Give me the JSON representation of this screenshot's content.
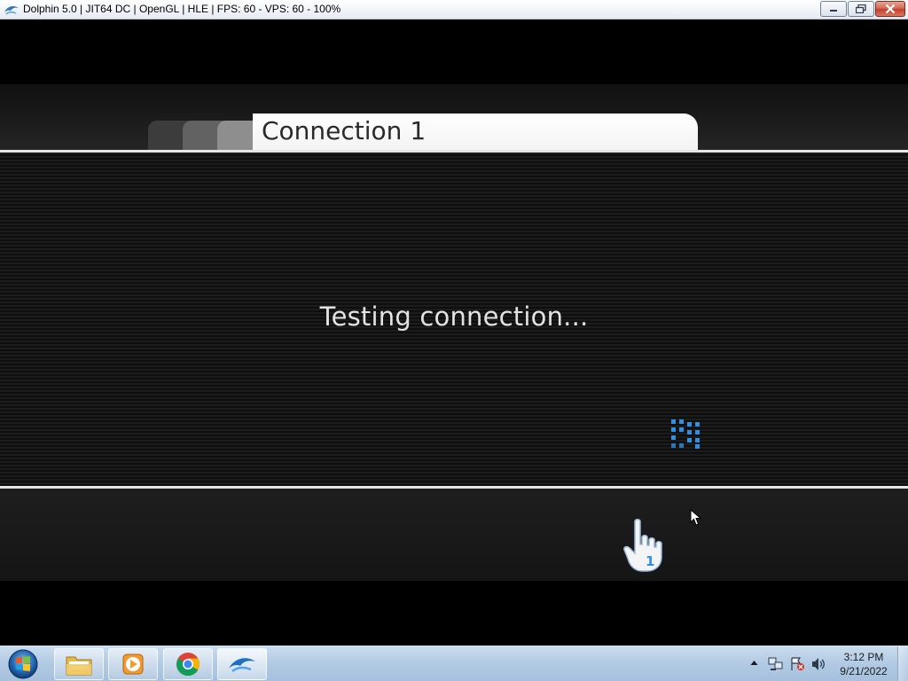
{
  "window": {
    "title": "Dolphin 5.0 | JIT64 DC | OpenGL | HLE | FPS: 60 - VPS: 60 - 100%",
    "icon": "dolphin-icon",
    "controls": [
      "minimize-icon",
      "restore-icon",
      "close-icon"
    ]
  },
  "game": {
    "tab_label": "Connection 1",
    "status": "Testing connection...",
    "spinner_color": "#2f8fe0",
    "pointer_player": "1"
  },
  "taskbar": {
    "start": "windows-start-orb",
    "pinned": [
      {
        "name": "File Explorer",
        "icon": "folder-icon"
      },
      {
        "name": "Windows Media Player",
        "icon": "media-player-icon"
      },
      {
        "name": "Google Chrome",
        "icon": "chrome-icon"
      },
      {
        "name": "Dolphin",
        "icon": "dolphin-icon",
        "active": true
      }
    ],
    "tray_icons": [
      "show-hidden-icons-arrow",
      "network-icon",
      "action-center-icon",
      "volume-icon"
    ],
    "clock": {
      "time": "3:12 PM",
      "date": "9/21/2022"
    }
  }
}
